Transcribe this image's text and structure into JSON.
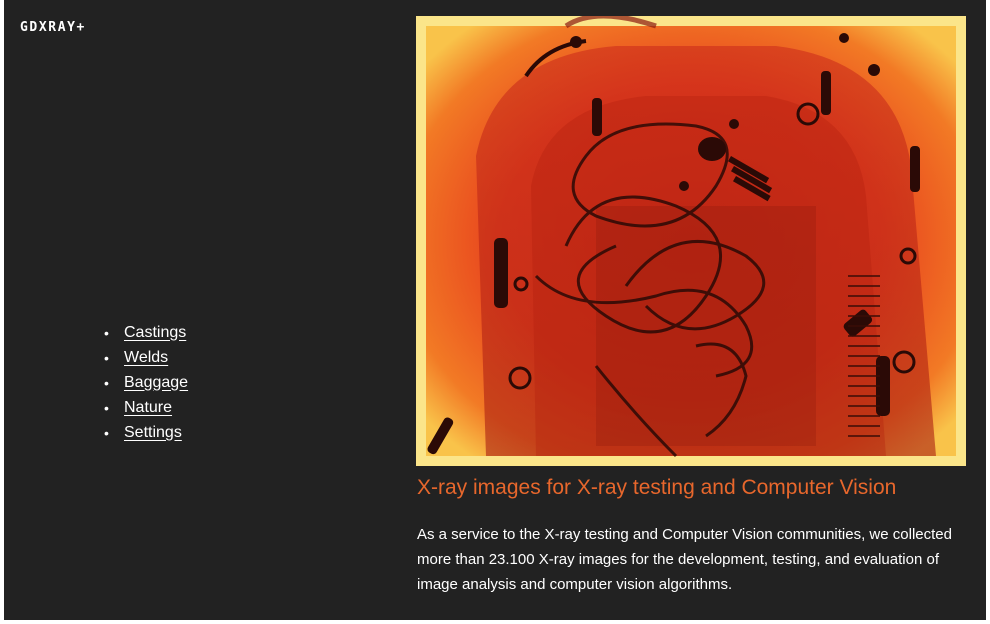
{
  "site": {
    "brand": "GDXRAY+"
  },
  "nav": {
    "items": [
      {
        "label": "Castings"
      },
      {
        "label": "Welds"
      },
      {
        "label": "Baggage"
      },
      {
        "label": "Nature"
      },
      {
        "label": "Settings"
      }
    ]
  },
  "hero": {
    "image_subject": "x-ray-backpack"
  },
  "main": {
    "headline": "X-ray images for X-ray testing and Computer Vision",
    "description": "As a service to the X-ray testing and Computer Vision communities, we collected more than 23.100 X-ray images for the development, testing, and evaluation of image analysis and computer vision algorithms."
  },
  "colors": {
    "background": "#222222",
    "accent": "#e8672c",
    "text": "#ffffff"
  }
}
